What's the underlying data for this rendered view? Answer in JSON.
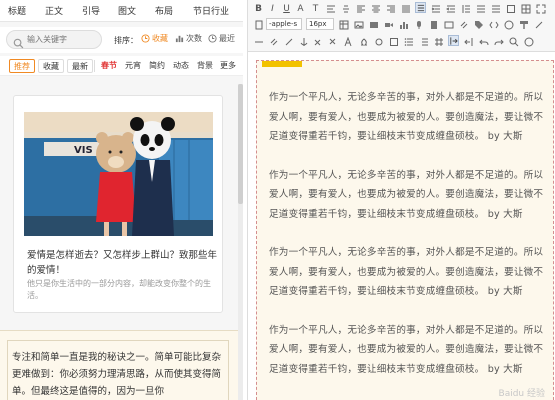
{
  "left_panel": {
    "nav": [
      "标题",
      "正文",
      "引导",
      "图文",
      "布局",
      "节日行业"
    ],
    "search": {
      "placeholder": "输入关键字"
    },
    "sort": {
      "label": "排序：",
      "options": [
        {
          "label": "收藏",
          "icon": "clock-icon",
          "active": true
        },
        {
          "label": "次数",
          "icon": "bar-chart-icon",
          "active": false
        },
        {
          "label": "最近",
          "icon": "clock-icon",
          "active": false
        }
      ]
    },
    "filters": [
      "推荐",
      "收藏",
      "最新",
      "春节",
      "元宵",
      "简约",
      "动态",
      "背景",
      "更多"
    ],
    "card1": {
      "photo_sign": "VIS",
      "title": "爱情是怎样逝去？又怎样步上群山？致那些年的爱情！",
      "desc": "他只是你生活中的一部分内容，却能改变你整个的生活。"
    },
    "card2": {
      "text": "专注和简单一直是我的秘诀之一。简单可能比复杂更难做到：你必须努力理清思路，从而使其变得简单。但最终这是值得的，因为一旦你"
    }
  },
  "toolbar": {
    "row1": [
      "B",
      "I",
      "U",
      "A",
      "T",
      "≡",
      "≡",
      "≡",
      "≡",
      "☰",
      "☰",
      "☰",
      "☰",
      "☰",
      "☰",
      "☰"
    ],
    "font_family": "-apple-s",
    "font_size": "16px"
  },
  "document": {
    "paragraphs": [
      "作为一个平凡人，无论多辛苦的事，对外人都是不足道的。所以爱人啊，要有爱人，也要成为被爱的人。要创造魔法，要让微不足道变得重若千钧，要让细枝末节变成缠盘硕枝。 by 大斯",
      "作为一个平凡人，无论多辛苦的事，对外人都是不足道的。所以爱人啊，要有爱人，也要成为被爱的人。要创造魔法，要让微不足道变得重若千钧，要让细枝末节变成缠盘硕枝。 by 大斯",
      "作为一个平凡人，无论多辛苦的事，对外人都是不足道的。所以爱人啊，要有爱人，也要成为被爱的人。要创造魔法，要让微不足道变得重若千钧，要让细枝末节变成缠盘硕枝。 by 大斯",
      "作为一个平凡人，无论多辛苦的事，对外人都是不足道的。所以爱人啊，要有爱人，也要成为被爱的人。要创造魔法，要让微不足道变得重若千钧，要让细枝末节变成缠盘硕枝。 by 大斯"
    ],
    "watermark": "Baidu 经验"
  },
  "colors": {
    "accent": "#f08a24",
    "red": "#e23c3c",
    "doc_bg": "#fdf8ec",
    "doc_accent": "#f2c200"
  }
}
